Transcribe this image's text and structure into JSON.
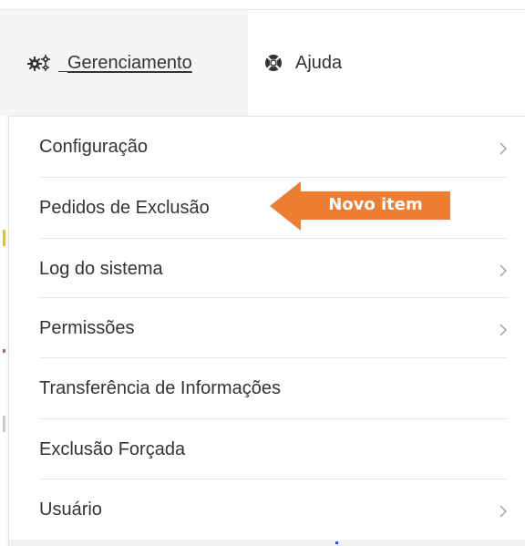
{
  "navbar": {
    "management": {
      "label": "Gerenciamento",
      "icon": "gears-icon"
    },
    "help": {
      "label": "Ajuda",
      "icon": "lifebuoy-icon"
    }
  },
  "dropdown": {
    "items": [
      {
        "label": "Configuração",
        "has_submenu": true
      },
      {
        "label": "Pedidos de Exclusão",
        "has_submenu": false
      },
      {
        "label": "Log do sistema",
        "has_submenu": true
      },
      {
        "label": "Permissões",
        "has_submenu": true
      },
      {
        "label": "Transferência de Informações",
        "has_submenu": false
      },
      {
        "label": "Exclusão Forçada",
        "has_submenu": false
      },
      {
        "label": "Usuário",
        "has_submenu": true
      }
    ]
  },
  "annotation": {
    "text": "Novo item",
    "color": "#ED7D31"
  },
  "colors": {
    "nav_active_bg": "#f5f5f5",
    "text": "#333333",
    "divider": "#e6e6e6",
    "chevron": "#999999"
  }
}
